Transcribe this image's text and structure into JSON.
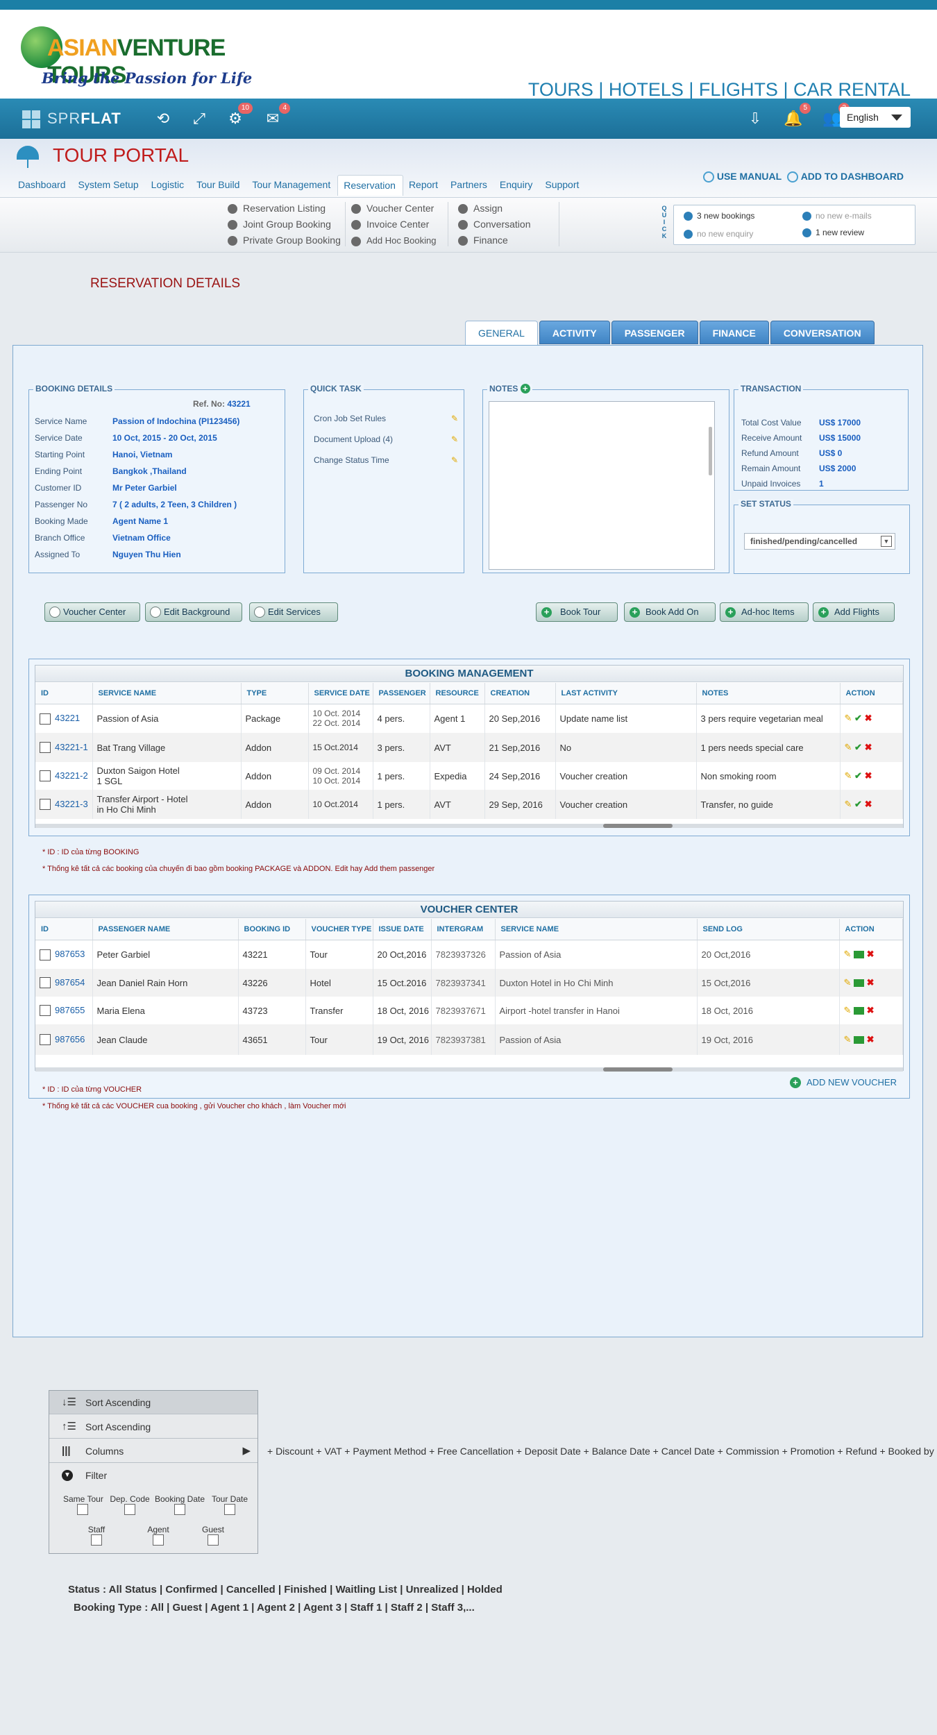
{
  "header": {
    "logo_name_a": "ASIAN",
    "logo_name_b": "VENTURE TOURS",
    "logo_tagline": "Bring the Passion for Life",
    "services": "TOURS | HOTELS | FLIGHTS | CAR RENTAL"
  },
  "adminbar": {
    "brand_a": "SPR",
    "brand_b": "FLAT",
    "settings_badge": "10",
    "mail_badge": "4",
    "bell_badge": "5",
    "users_badge": "3",
    "language": "English"
  },
  "portal": {
    "title": "TOUR PORTAL",
    "nav": [
      "Dashboard",
      "System Setup",
      "Logistic",
      "Tour Build",
      "Tour Management",
      "Reservation",
      "Report",
      "Partners",
      "Enquiry",
      "Support"
    ],
    "active_nav": "Reservation",
    "user_manual": "USE MANUAL",
    "add_dashboard": "ADD TO  DASHBOARD"
  },
  "submenu": {
    "col1": [
      "Reservation Listing",
      "Joint Group Booking",
      "Private Group Booking"
    ],
    "col2": [
      "Voucher Center",
      "Invoice Center",
      "Add Hoc Booking"
    ],
    "col3": [
      "Assign",
      "Conversation",
      "Finance"
    ],
    "quick_label": "QUICK",
    "quick": {
      "new_bookings": "3 new bookings",
      "new_emails": "no new e-mails",
      "new_enquiry": "no new enquiry",
      "new_review": "1 new review"
    }
  },
  "page": {
    "title": "RESERVATION DETAILS",
    "tabs": [
      "GENERAL",
      "ACTIVITY",
      "PASSENGER",
      "FINANCE",
      "CONVERSATION"
    ]
  },
  "booking_details": {
    "legend": "BOOKING DETAILS",
    "ref_label": "Ref. No:",
    "ref_value": "43221",
    "rows": [
      {
        "label": "Service Name",
        "value": "Passion of Indochina (PI123456)"
      },
      {
        "label": "Service  Date",
        "value": "10 Oct, 2015  - 20 Oct, 2015"
      },
      {
        "label": "Starting Point",
        "value": "Hanoi, Vietnam"
      },
      {
        "label": "Ending Point",
        "value": "Bangkok ,Thailand"
      },
      {
        "label": "Customer  ID",
        "value": "Mr Peter Garbiel"
      },
      {
        "label": "Passenger No",
        "value": "7  ( 2 adults, 2 Teen, 3 Children )"
      },
      {
        "label": "Booking Made",
        "value": "Agent Name 1"
      },
      {
        "label": "Branch Office",
        "value": "Vietnam Office"
      },
      {
        "label": "Assigned  To",
        "value": "Nguyen Thu Hien"
      }
    ]
  },
  "quick_task": {
    "legend": "QUICK TASK",
    "items": [
      "Cron Job Set Rules",
      "Document Upload (4)",
      "Change Status Time"
    ]
  },
  "notes": {
    "legend": "NOTES"
  },
  "transaction": {
    "legend": "TRANSACTION",
    "rows": [
      {
        "label": "Total Cost Value",
        "value": "US$ 17000"
      },
      {
        "label": "Receive Amount",
        "value": "US$ 15000"
      },
      {
        "label": "Refund  Amount",
        "value": "US$ 0"
      },
      {
        "label": "Remain Amount",
        "value": "US$ 2000"
      },
      {
        "label": "Unpaid Invoices",
        "value": "1"
      }
    ]
  },
  "set_status": {
    "legend": "SET STATUS",
    "value": "finished/pending/cancelled"
  },
  "actions": {
    "voucher_center": "Voucher Center",
    "edit_background": "Edit Background",
    "edit_services": "Edit Services",
    "book_tour": "Book Tour",
    "book_addon": "Book Add On",
    "adhoc": "Ad-hoc Items",
    "add_flights": "Add Flights"
  },
  "booking_management": {
    "title": "BOOKING MANAGEMENT",
    "columns": [
      "ID",
      "SERVICE NAME",
      "TYPE",
      "SERVICE DATE",
      "PASSENGER",
      "RESOURCE",
      "CREATION",
      "LAST ACTIVITY",
      "NOTES",
      "ACTION"
    ],
    "rows": [
      {
        "id": "43221",
        "service": "Passion of Asia",
        "type": "Package",
        "date": "10 Oct. 2014\n22 Oct. 2014",
        "pax": "4 pers.",
        "resource": "Agent 1",
        "creation": "20 Sep,2016",
        "activity": "Update name list",
        "notes": "3 pers require vegetarian meal"
      },
      {
        "id": "43221-1",
        "service": "Bat Trang Village",
        "type": "Addon",
        "date": "15 Oct.2014",
        "pax": "3 pers.",
        "resource": "AVT",
        "creation": " 21 Sep,2016",
        "activity": "No",
        "notes": "1 pers needs special care"
      },
      {
        "id": "43221-2",
        "service": "Duxton Saigon Hotel\n1 SGL",
        "type": "Addon",
        "date": "09 Oct. 2014\n10 Oct. 2014",
        "pax": "1 pers.",
        "resource": "Expedia",
        "creation": "24 Sep,2016",
        "activity": "Voucher creation",
        "notes": "Non smoking room"
      },
      {
        "id": "43221-3",
        "service": "Transfer Airport - Hotel\nin Ho Chi Minh",
        "type": "Addon",
        "date": "10 Oct.2014",
        "pax": "1 pers.",
        "resource": "AVT",
        "creation": "29 Sep, 2016",
        "activity": "Voucher creation",
        "notes": "Transfer, no  guide"
      }
    ],
    "note1": "* ID : ID của  từng BOOKING",
    "note2": "*  Thống kê tất cả các booking của chuyến đi bao gồm booking PACKAGE và ADDON.  Edit hay Add them passenger"
  },
  "voucher_center": {
    "title": "VOUCHER CENTER",
    "columns": [
      "ID",
      "PASSENGER NAME",
      "BOOKING ID",
      "VOUCHER TYPE",
      "ISSUE DATE",
      "INTERGRAM",
      "SERVICE NAME",
      "SEND LOG",
      "ACTION"
    ],
    "rows": [
      {
        "id": "987653",
        "name": "Peter Garbiel",
        "booking": "43221",
        "vtype": "Tour",
        "issue": "20 Oct,2016",
        "inter": "7823937326",
        "service": "Passion of Asia",
        "log": "20 Oct,2016"
      },
      {
        "id": "987654",
        "name": "Jean Daniel Rain Horn",
        "booking": "43226",
        "vtype": "Hotel",
        "issue": "15 Oct.2016",
        "inter": "7823937341",
        "service": "Duxton Hotel in Ho Chi Minh",
        "log": "15 Oct,2016"
      },
      {
        "id": "987655",
        "name": "Maria Elena",
        "booking": "43723",
        "vtype": "Transfer",
        "issue": "18 Oct, 2016",
        "inter": "7823937671",
        "service": "Airport -hotel transfer in Hanoi",
        "log": "18 Oct, 2016"
      },
      {
        "id": "987656",
        "name": "Jean Claude",
        "booking": "43651",
        "vtype": "Tour",
        "issue": "19 Oct, 2016",
        "inter": "7823937381",
        "service": "Passion of Asia",
        "log": "19 Oct, 2016"
      }
    ],
    "add_new": "ADD NEW VOUCHER",
    "note1": "* ID : ID của  từng VOUCHER",
    "note2": "*  Thống kê tất cả các VOUCHER  cua  booking , gửi Voucher cho khách , làm Voucher mới"
  },
  "context_menu": {
    "sort_asc_1": "Sort Ascending",
    "sort_asc_2": "Sort Ascending",
    "columns": "Columns",
    "filter": "Filter",
    "filters": [
      "Same Tour",
      "Dep. Code",
      "Booking Date",
      "Tour Date",
      "Staff",
      "Agent",
      "Guest"
    ],
    "extra_columns": "+ Discount  + VAT  + Payment Method + Free Cancellation +  Deposit Date    + Balance Date  + Cancel Date + Commission  + Promotion + Refund   + Booked by"
  },
  "legend_lines": {
    "status": "Status : All Status | Confirmed | Cancelled | Finished | Waitling List  | Unrealized  | Holded",
    "booking_type": "Booking Type : All | Guest | Agent 1 | Agent 2 | Agent 3 | Staff 1 | Staff 2 | Staff 3,..."
  }
}
